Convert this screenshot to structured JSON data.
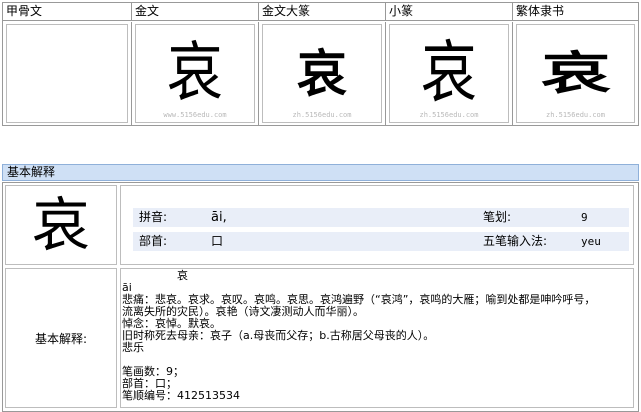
{
  "script_forms": {
    "headers": [
      "甲骨文",
      "金文",
      "金文大篆",
      "小篆",
      "繁体隶书"
    ],
    "glyphs": [
      "",
      "哀",
      "哀",
      "哀",
      "哀"
    ],
    "watermarks": [
      "",
      "www.5156edu.com",
      "zh.5156edu.com",
      "zh.5156edu.com",
      "zh.5156edu.com"
    ]
  },
  "basic": {
    "section_title": "基本解释",
    "character": "哀",
    "pinyin_label": "拼音:",
    "pinyin_value": "āi,",
    "strokes_label": "笔划:",
    "strokes_value": "9",
    "radical_label": "部首:",
    "radical_value": "口",
    "wubi_label": "五笔输入法:",
    "wubi_value": "yeu",
    "explain_label": "基本解释:",
    "definition_lines": [
      "　　　　　哀",
      "āi",
      "悲痛：悲哀。哀求。哀叹。哀鸣。哀思。哀鸿遍野（“哀鸿”，哀鸣的大雁；喻到处都是呻吟呼号，",
      "流离失所的灾民）。哀艳（诗文凄测动人而华丽）。",
      "悼念：哀悼。默哀。",
      "旧时称死去母亲：哀子（a.母丧而父存；b.古称居父母丧的人）。",
      "悲乐",
      "",
      "笔画数：9；",
      "部首：口；",
      "笔顺编号：412513534"
    ]
  }
}
